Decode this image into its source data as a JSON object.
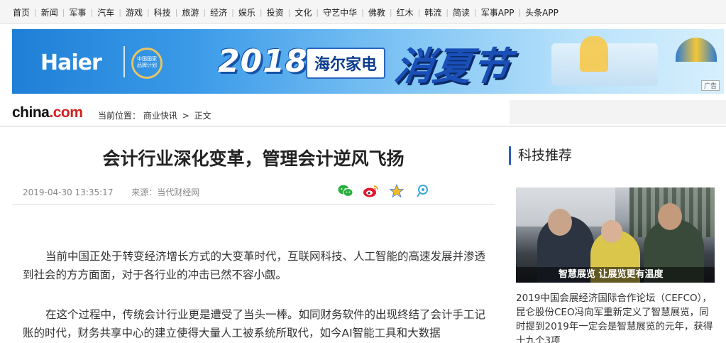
{
  "nav": {
    "items": [
      "首页",
      "新闻",
      "军事",
      "汽车",
      "游戏",
      "科技",
      "旅游",
      "经济",
      "娱乐",
      "投资",
      "文化",
      "守艺中华",
      "佛教",
      "红木",
      "韩流",
      "简读",
      "军事APP",
      "头条APP"
    ]
  },
  "banner": {
    "brand": "Haier",
    "badge_text": "中国国家品牌计划",
    "year": "2018",
    "product": "海尔家电",
    "festival": "消夏节",
    "ad_tag": "广告"
  },
  "site": {
    "logo_main": "china",
    "logo_dot": ".",
    "logo_com": "com",
    "breadcrumb_prefix": "当前位置：",
    "breadcrumb_section": "商业快讯",
    "breadcrumb_arrow": ">",
    "breadcrumb_current": "正文"
  },
  "article": {
    "title": "会计行业深化变革，管理会计逆风飞扬",
    "date": "2019-04-30 13:35:17",
    "source": "来源：当代财经网",
    "paragraphs": [
      "当前中国正处于转变经济增长方式的大变革时代，互联网科技、人工智能的高速发展并渗透到社会的方方面面，对于各行业的冲击已然不容小觑。",
      "在这个过程中，传统会计行业更是遭受了当头一棒。如同财务软件的出现终结了会计手工记账的时代，财务共享中心的建立使得大量人工被系统所取代，如今AI智能工具和大数据"
    ],
    "share_icons": [
      "wechat-icon",
      "weibo-icon",
      "qzone-icon",
      "tencent-weibo-icon"
    ]
  },
  "sidebar": {
    "title": "科技推荐",
    "photo_caption": "智慧展览 让展览更有温度",
    "story_text": "2019中国会展经济国际合作论坛（CEFCO），昆仑股份CEO冯向军重新定义了智慧展览，同时提到2019年一定会是智慧展览的元年，获得十九个3项"
  },
  "colors": {
    "accent": "#2b5fb6",
    "logo_red": "#d4201f",
    "banner_blue": "#1f7fd6"
  }
}
